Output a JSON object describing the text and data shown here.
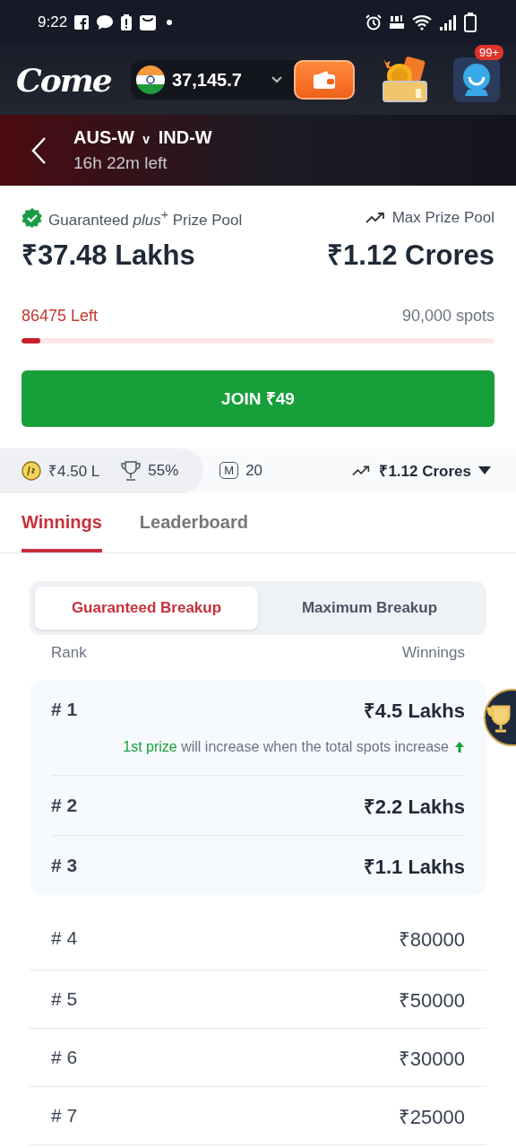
{
  "status_bar": {
    "time": "9:22"
  },
  "header": {
    "logo": "Come",
    "balance": "37,145.7",
    "notification_badge": "99+"
  },
  "match": {
    "team_1": "AUS-W",
    "versus": "v",
    "team_2": "IND-W",
    "time_left": "16h 22m left"
  },
  "prize_pool": {
    "guaranteed_label": "Guaranteed *plus*$^{+}$ Prize Pool",
    "guaranteed_amount": "₹37.48 Lakhs",
    "max_label": "Max Prize Pool",
    "max_amount": "₹1.12 Crores",
    "spots_left": "86475 Left",
    "total_spots": "90,000 spots",
    "level": 0.04
  },
  "join_button": "JOIN ₹49",
  "stats": {
    "first_prize": "₹4.50 L",
    "win_percent": "55%",
    "max_entries_badge": "M",
    "max_entries": "20",
    "max_prize": "₹1.12 Crores"
  },
  "tabs": [
    {
      "label": "Winnings",
      "selected": true
    },
    {
      "label": "Leaderboard",
      "selected": false
    }
  ],
  "breakup_tabs": [
    {
      "label": "Guaranteed Breakup",
      "selected": true
    },
    {
      "label": "Maximum Breakup",
      "selected": false
    }
  ],
  "columns": [
    "Rank",
    "Winnings"
  ],
  "top_ranks": [
    {
      "rank": "# 1",
      "prize": "₹4.5 Lakhs",
      "note_highlight": "1st prize",
      "note": "will increase when the total spots increase"
    },
    {
      "rank": "# 2",
      "prize": "₹2.2 Lakhs"
    },
    {
      "rank": "# 3",
      "prize": "₹1.1 Lakhs"
    }
  ],
  "other_ranks": [
    {
      "rank": "# 4",
      "prize": "₹80000"
    },
    {
      "rank": "# 5",
      "prize": "₹50000"
    },
    {
      "rank": "# 6",
      "prize": "₹30000"
    },
    {
      "rank": "# 7",
      "prize": "₹25000"
    }
  ]
}
